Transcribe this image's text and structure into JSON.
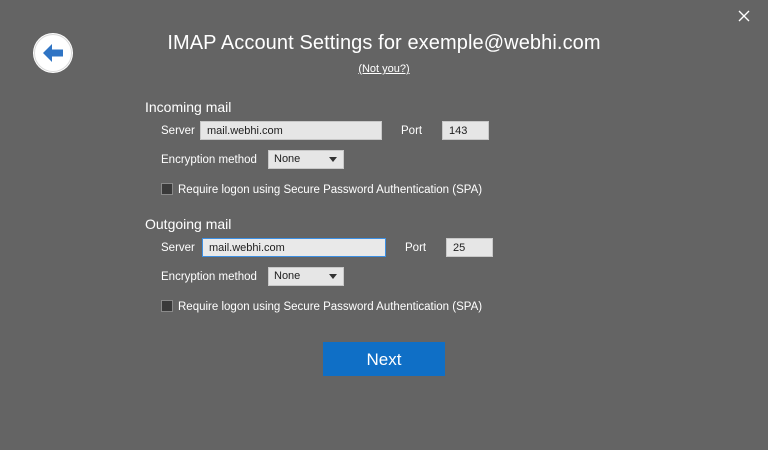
{
  "dialog": {
    "title": "IMAP Account Settings for exemple@webhi.com",
    "not_you": "(Not you?)"
  },
  "incoming": {
    "heading": "Incoming mail",
    "server_label": "Server",
    "server_value": "mail.webhi.com",
    "port_label": "Port",
    "port_value": "143",
    "encryption_label": "Encryption method",
    "encryption_value": "None",
    "spa_label": "Require logon using Secure Password Authentication (SPA)",
    "spa_checked": false
  },
  "outgoing": {
    "heading": "Outgoing mail",
    "server_label": "Server",
    "server_value": "mail.webhi.com",
    "port_label": "Port",
    "port_value": "25",
    "encryption_label": "Encryption method",
    "encryption_value": "None",
    "spa_label": "Require logon using Secure Password Authentication (SPA)",
    "spa_checked": false
  },
  "actions": {
    "next_label": "Next"
  },
  "icons": {
    "back": "back-arrow-icon",
    "close": "close-icon",
    "dropdown": "chevron-down-icon"
  },
  "colors": {
    "background": "#646464",
    "accent": "#0f6fc6",
    "back_arrow": "#2f74c4",
    "focus_border": "#3c8fe3"
  }
}
